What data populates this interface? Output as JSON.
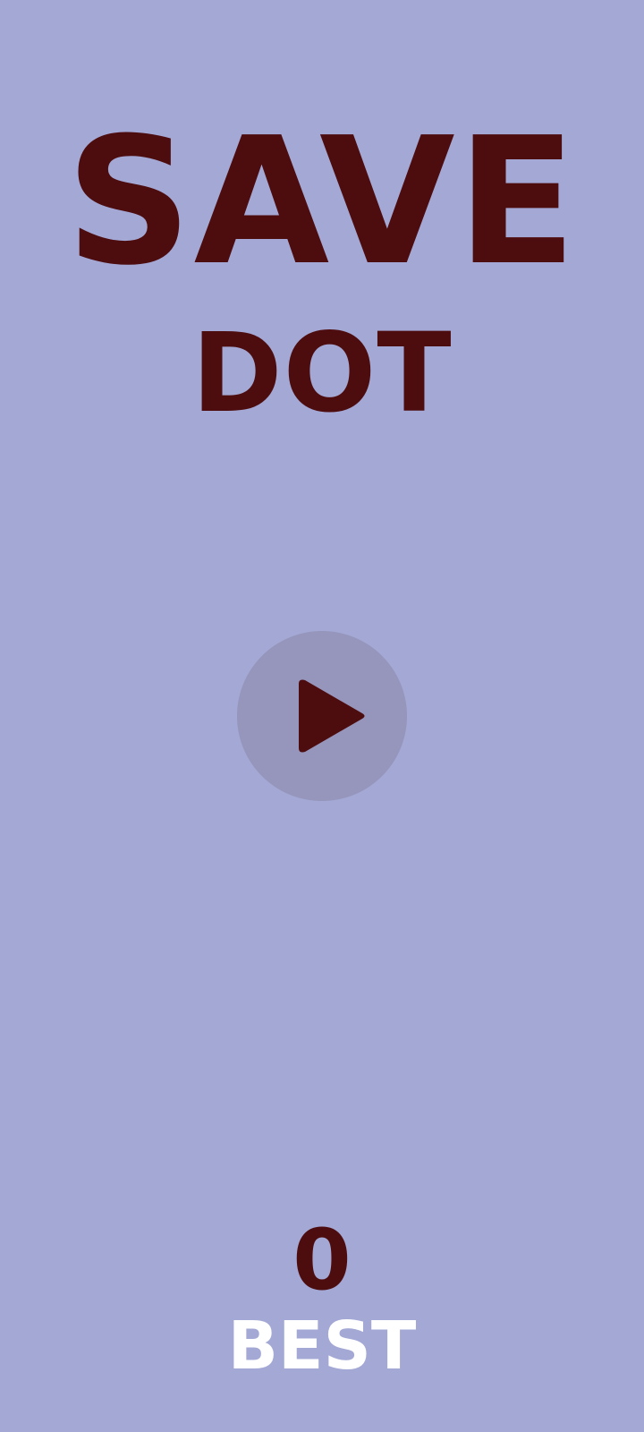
{
  "title": {
    "line1": "SAVE",
    "line2": "DOT"
  },
  "play_button": {
    "icon": "play-icon"
  },
  "score": {
    "best_value": "0",
    "best_label": "BEST"
  },
  "colors": {
    "background": "#a3a8d5",
    "title": "#4d0c0e",
    "play_circle": "#9695bb",
    "best_label": "#ffffff"
  }
}
